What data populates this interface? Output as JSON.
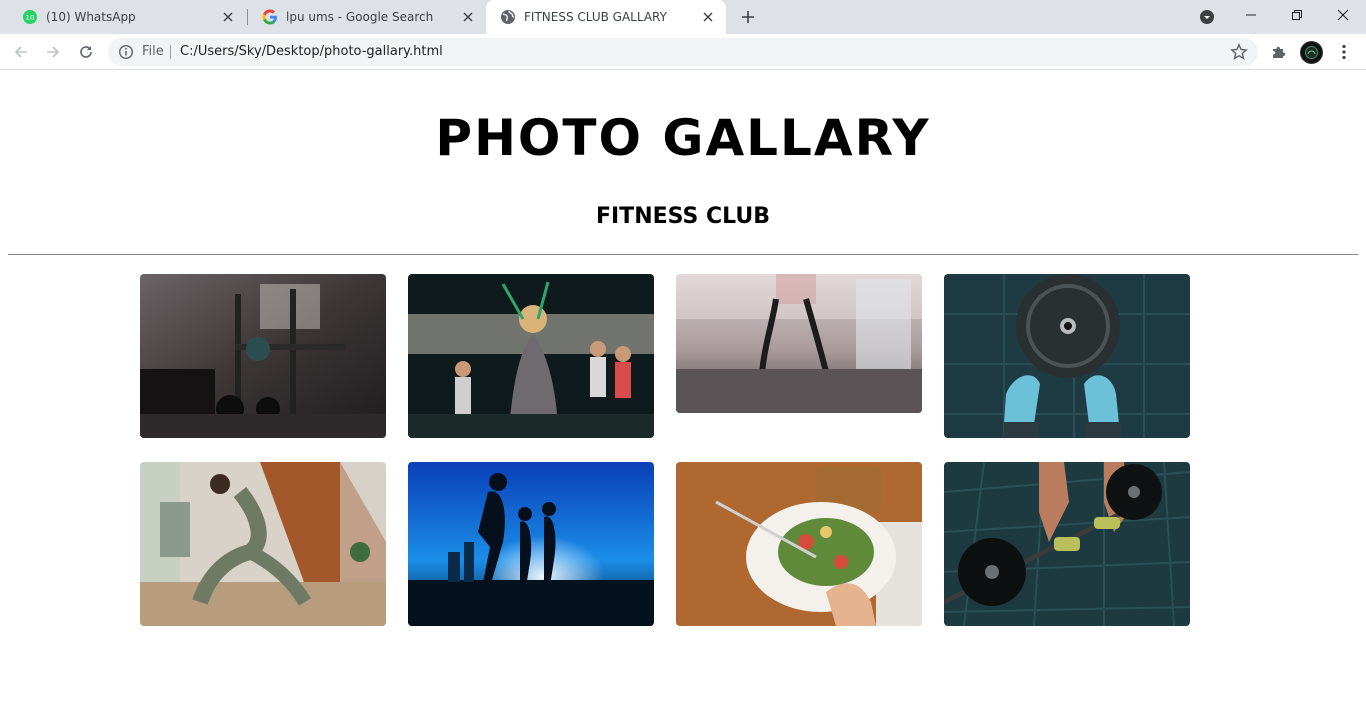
{
  "browser": {
    "tabs": [
      {
        "title": "(10) WhatsApp",
        "badge": "10",
        "active": false
      },
      {
        "title": "lpu ums - Google Search",
        "active": false
      },
      {
        "title": "FITNESS CLUB GALLARY",
        "active": true
      }
    ],
    "address": {
      "scheme_label": "File",
      "url": "C:/Users/Sky/Desktop/photo-gallary.html"
    },
    "icons": {
      "back": "back-arrow-icon",
      "forward": "forward-arrow-icon",
      "reload": "reload-icon",
      "info": "info-icon",
      "bookmark": "star-icon",
      "extensions": "puzzle-icon",
      "menu": "kebab-menu-icon"
    }
  },
  "page": {
    "title": "PHOTO GALLARY",
    "subtitle": "FITNESS CLUB",
    "gallery": [
      {
        "subject": "gym equipment"
      },
      {
        "subject": "resistance band class"
      },
      {
        "subject": "battle ropes"
      },
      {
        "subject": "weight plate and sneakers"
      },
      {
        "subject": "yoga pose"
      },
      {
        "subject": "runners silhouette"
      },
      {
        "subject": "salad plate"
      },
      {
        "subject": "barbell lift"
      }
    ]
  },
  "colors": {
    "tabstrip": "#dee1e6",
    "omnibox": "#f1f3f4",
    "whatsapp": "#25d366",
    "rule": "#8a8a8a"
  }
}
